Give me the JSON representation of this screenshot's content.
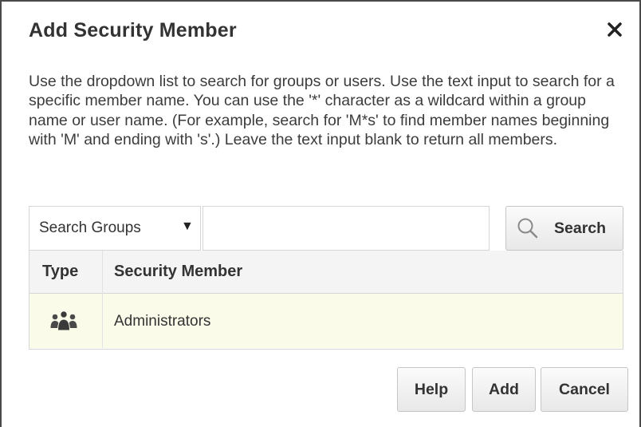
{
  "dialog": {
    "title": "Add Security Member",
    "close_icon": "close-icon",
    "description": "Use the dropdown list to search for groups or users. Use the text input to search for a specific member name. You can use the '*' character as a wildcard within a group name or user name. (For example, search for 'M*s' to find member names beginning with 'M' and ending with 's'.) Leave the text input blank to return all members."
  },
  "search": {
    "scope_selected": "Search Groups",
    "scope_arrow": "▼",
    "input_value": "",
    "input_placeholder": "",
    "button_label": "Search",
    "button_icon": "search-icon"
  },
  "table": {
    "columns": [
      "Type",
      "Security Member"
    ],
    "rows": [
      {
        "type_icon": "group-icon",
        "name": "Administrators"
      }
    ]
  },
  "footer": {
    "help_label": "Help",
    "add_label": "Add",
    "cancel_label": "Cancel"
  },
  "colors": {
    "selected_row": "#fbfbe9",
    "header_bg": "#f4f4f4",
    "border": "#d6d6d6",
    "text": "#333333"
  }
}
